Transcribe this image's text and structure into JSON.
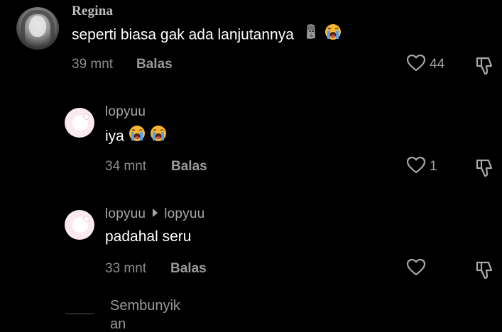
{
  "comments": [
    {
      "username": "Regina",
      "text": "seperti biasa gak ada lanjutannya",
      "time": "39 mnt",
      "reply_label": "Balas",
      "likes": "44"
    },
    {
      "username": "lopyuu",
      "text": "iya",
      "time": "34 mnt",
      "reply_label": "Balas",
      "likes": "1"
    },
    {
      "username": "lopyuu",
      "reply_to": "lopyuu",
      "text": "padahal seru",
      "time": "33 mnt",
      "reply_label": "Balas",
      "likes": ""
    }
  ],
  "more_replies": {
    "label": "Sembunyikan"
  },
  "icons": {
    "like": "heart-outline-icon",
    "dislike": "thumbs-down-outline-icon",
    "emoji_moai": "moai-emoji-icon",
    "emoji_crying": "loudly-crying-face-emoji-icon"
  },
  "colors": {
    "background": "#000000",
    "text_primary": "#ffffff",
    "text_secondary": "#8c8c8c"
  }
}
